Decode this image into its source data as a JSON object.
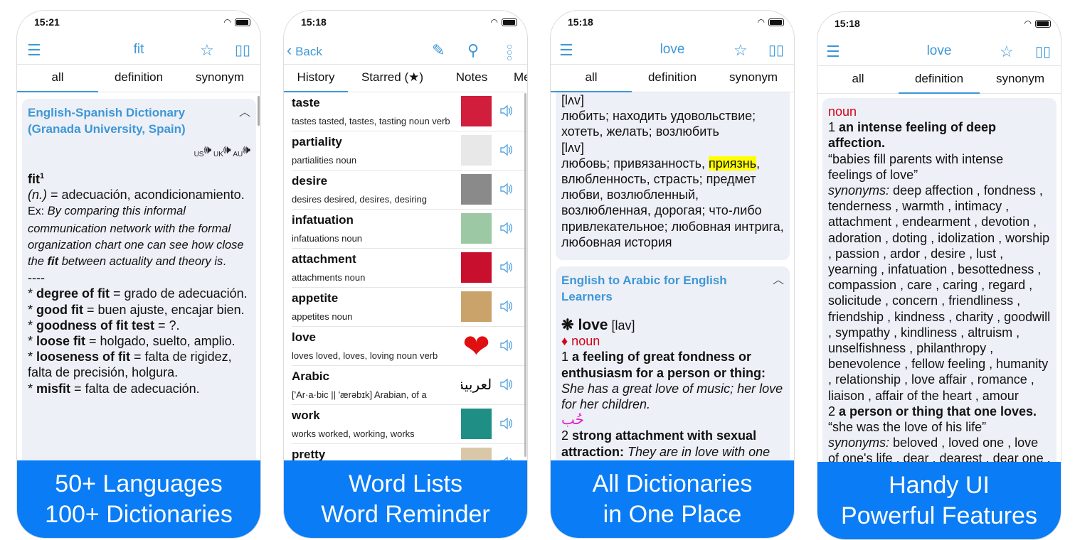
{
  "colors": {
    "accent": "#3d97d6",
    "banner": "#0a7cf5",
    "card": "#eef0f7",
    "highlight": "#ffff00",
    "pos": "#d0021b"
  },
  "phone1": {
    "time": "15:21",
    "nav": {
      "title": "fit",
      "left_icon": "menu-icon",
      "right_icons": [
        "star-icon",
        "book-icon"
      ]
    },
    "tabs": [
      "all",
      "definition",
      "synonym"
    ],
    "active_tab": "all",
    "card": {
      "title": "English-Spanish Dictionary (Granada University, Spain)",
      "audio": [
        "US",
        "UK",
        "AU"
      ],
      "paras": [
        [
          {
            "t": "fit",
            "s": "b"
          },
          {
            "t": "1",
            "s": "sup"
          }
        ],
        [
          {
            "t": "(n.)",
            "s": "i"
          },
          {
            "t": " = adecuación, acondicionamiento.",
            "s": ""
          }
        ],
        [
          {
            "t": "Ex: ",
            "s": "sm"
          },
          {
            "t": "By comparing this informal communication network with the formal organization chart one can see how close the ",
            "s": "ism"
          },
          {
            "t": "fit",
            "s": "bi"
          },
          {
            "t": " between actuality and theory is",
            "s": "ism"
          },
          {
            "t": ".",
            "s": "sm"
          }
        ],
        [
          {
            "t": "----",
            "s": ""
          }
        ],
        [
          {
            "t": "* ",
            "s": ""
          },
          {
            "t": "degree of fit",
            "s": "b"
          },
          {
            "t": " = grado de adecuación.",
            "s": ""
          }
        ],
        [
          {
            "t": "* ",
            "s": ""
          },
          {
            "t": "good fit",
            "s": "b"
          },
          {
            "t": " = buen ajuste, encajar bien.",
            "s": ""
          }
        ],
        [
          {
            "t": "* ",
            "s": ""
          },
          {
            "t": "goodness of fit test",
            "s": "b"
          },
          {
            "t": " = ?.",
            "s": ""
          }
        ],
        [
          {
            "t": "* ",
            "s": ""
          },
          {
            "t": "loose fit",
            "s": "b"
          },
          {
            "t": " = holgado, suelto, amplio.",
            "s": ""
          }
        ],
        [
          {
            "t": "* ",
            "s": ""
          },
          {
            "t": "looseness of fit",
            "s": "b"
          },
          {
            "t": " = falta de rigidez, falta de precisión, holgura.",
            "s": ""
          }
        ],
        [
          {
            "t": "* ",
            "s": ""
          },
          {
            "t": "misfit",
            "s": "b"
          },
          {
            "t": " = falta de adecuación.",
            "s": ""
          }
        ]
      ]
    },
    "banner": [
      "50+ Languages",
      "100+ Dictionaries"
    ]
  },
  "phone2": {
    "time": "15:18",
    "nav": {
      "back": "Back",
      "right_icons": [
        "pencil-icon",
        "search-icon",
        "more-icon"
      ]
    },
    "tabs": [
      "History",
      "Starred (★)",
      "Notes",
      "Me"
    ],
    "active_tab": "History",
    "rows": [
      {
        "word": "taste",
        "forms": "tastes tasted, tastes, tasting noun verb",
        "thumb": "#d01e3c"
      },
      {
        "word": "partiality",
        "forms": "partialities noun",
        "thumb": "#e8e8e8"
      },
      {
        "word": "desire",
        "forms": "desires desired, desires, desiring",
        "thumb": "#8a8a8a"
      },
      {
        "word": "infatuation",
        "forms": "infatuations noun",
        "thumb": "#9cc9a4"
      },
      {
        "word": "attachment",
        "forms": "attachments noun",
        "thumb": "#c8102e"
      },
      {
        "word": "appetite",
        "forms": "appetites noun",
        "thumb": "#c9a36a"
      },
      {
        "word": "love",
        "forms": "loves loved, loves, loving noun verb",
        "thumb": "heart"
      },
      {
        "word": "Arabic",
        "forms": "['Ar·a·bic || 'ærəbɪk] Arabian, of a",
        "thumb": "العربية"
      },
      {
        "word": "work",
        "forms": "works worked, working, works",
        "thumb": "#1f8f86"
      },
      {
        "word": "pretty",
        "forms": "",
        "thumb": "#d9c8a8"
      }
    ],
    "banner": [
      "Word Lists",
      "Word Reminder"
    ]
  },
  "phone3": {
    "time": "15:18",
    "nav": {
      "title": "love",
      "left_icon": "menu-icon",
      "right_icons": [
        "star-icon",
        "book-icon"
      ]
    },
    "tabs": [
      "all",
      "definition",
      "synonym"
    ],
    "active_tab": "all",
    "card1": {
      "paras": [
        [
          {
            "t": "[lʌv]",
            "s": ""
          }
        ],
        [
          {
            "t": "любить; находить удовольствие; хотеть, желать; возлюбить",
            "s": ""
          }
        ],
        [
          {
            "t": "[lʌv]",
            "s": ""
          }
        ],
        [
          {
            "t": "любовь; привязанность, ",
            "s": ""
          },
          {
            "t": "приязнь",
            "s": "hl"
          },
          {
            "t": ", влюбленность, страсть; предмет любви, возлюбленный, возлюбленная, дорогая; что-либо привлекательное; любовная интрига, любовная история",
            "s": ""
          }
        ]
      ]
    },
    "card2": {
      "title": "English to Arabic for English Learners",
      "paras": [
        [
          {
            "t": "❋ ",
            "s": "big"
          },
          {
            "t": "love",
            "s": "big"
          },
          {
            "t": " [lav]",
            "s": ""
          }
        ],
        [
          {
            "t": "♦ noun",
            "s": "red"
          }
        ],
        [
          {
            "t": "1 ",
            "s": ""
          },
          {
            "t": "a feeling of great fondness or enthusiasm for a person or thing:",
            "s": "b"
          },
          {
            "t": " She has a great love of music; her love for her children.",
            "s": "i"
          }
        ],
        [
          {
            "t": "حُب",
            "s": "mag"
          }
        ],
        [
          {
            "t": "2 ",
            "s": ""
          },
          {
            "t": "strong attachment with sexual attraction:",
            "s": "b"
          },
          {
            "t": " They are in love with one",
            "s": "i"
          }
        ]
      ]
    },
    "banner": [
      "All Dictionaries",
      "in One Place"
    ]
  },
  "phone4": {
    "time": "15:18",
    "nav": {
      "title": "love",
      "left_icon": "menu-icon",
      "right_icons": [
        "star-icon",
        "book-icon"
      ]
    },
    "tabs": [
      "all",
      "definition",
      "synonym"
    ],
    "active_tab": "definition",
    "card": {
      "paras": [
        [
          {
            "t": "noun",
            "s": "red"
          }
        ],
        [
          {
            "t": "1 ",
            "s": ""
          },
          {
            "t": "an intense feeling of deep affection.",
            "s": "b"
          }
        ],
        [
          {
            "t": "“babies fill parents with intense feelings of love”",
            "s": ""
          }
        ],
        [
          {
            "t": "synonyms:",
            "s": "i"
          },
          {
            "t": " deep affection , fondness , tenderness , warmth , intimacy , attachment , endearment , devotion , adoration , doting , idolization , worship , passion , ardor , desire , lust , yearning , infatuation , besottedness , compassion , care , caring , regard , solicitude , concern , friendliness , friendship , kindness , charity , goodwill , sympathy , kindliness , altruism , unselfishness , philanthropy , benevolence , fellow feeling , humanity , relationship , love affair , romance , liaison , affair of the heart , amour",
            "s": ""
          }
        ],
        [
          {
            "t": " ",
            "s": ""
          }
        ],
        [
          {
            "t": "2 ",
            "s": ""
          },
          {
            "t": "a person or thing that one loves.",
            "s": "b"
          }
        ],
        [
          {
            "t": "“she was the love of his life”",
            "s": ""
          }
        ],
        [
          {
            "t": "synonyms:",
            "s": "i"
          },
          {
            "t": " beloved , loved one , love of one's life , dear , dearest , dear one ,",
            "s": ""
          }
        ]
      ]
    },
    "banner": [
      "Handy UI",
      "Powerful Features"
    ]
  }
}
